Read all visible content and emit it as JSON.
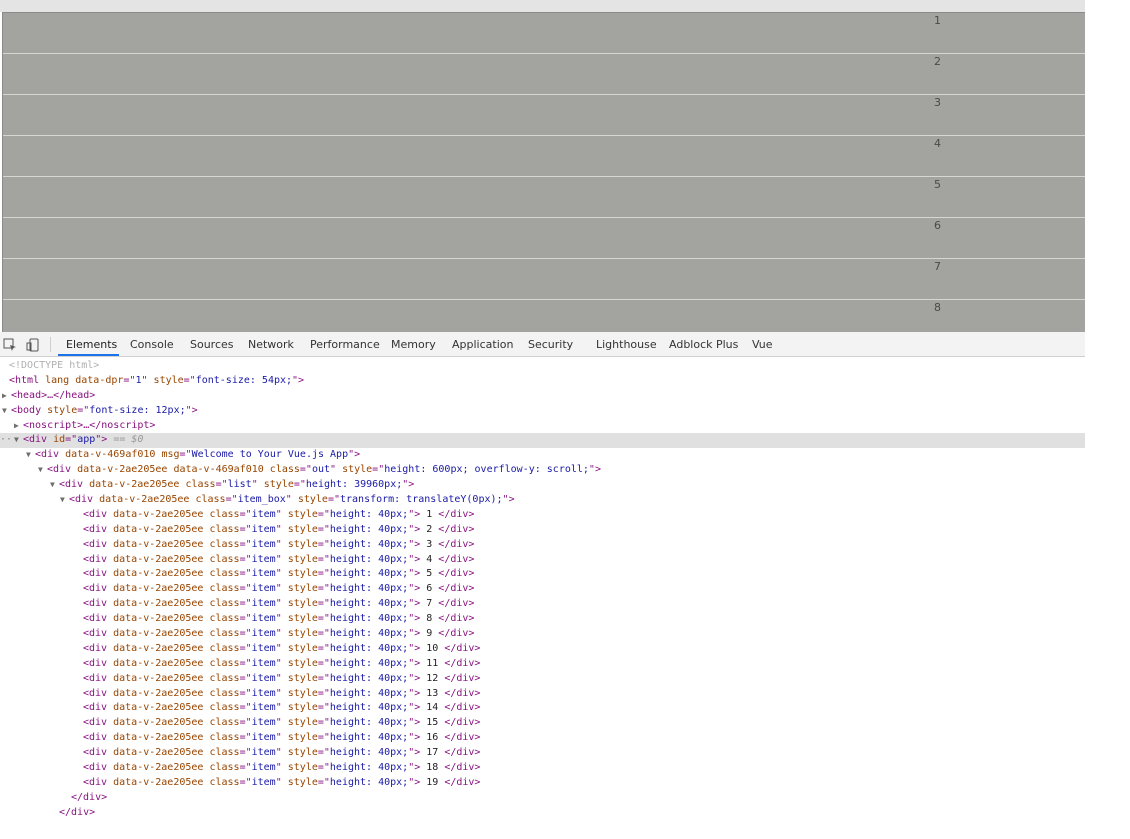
{
  "viewport": {
    "items": [
      "1",
      "2",
      "3",
      "4",
      "5",
      "6",
      "7",
      "8"
    ]
  },
  "devtools": {
    "tabs": [
      "Elements",
      "Console",
      "Sources",
      "Network",
      "Performance",
      "Memory",
      "Application",
      "Security",
      "Lighthouse",
      "Adblock Plus",
      "Vue"
    ],
    "active_tab": "Elements",
    "dom": {
      "doctype": "<!DOCTYPE html>",
      "html_open": {
        "tag": "html",
        "lang_attr": "lang",
        "dpr_attr": "data-dpr",
        "dpr_val": "1",
        "style_attr": "style",
        "style_val": "font-size: 54px;"
      },
      "head": "<head>…</head>",
      "body_open": {
        "style_val": "font-size: 12px;"
      },
      "noscript": "<noscript>…</noscript>",
      "app": {
        "id_val": "app",
        "marker": "== $0"
      },
      "hello": {
        "attr": "data-v-469af010",
        "msg_val": "Welcome to Your Vue.js App"
      },
      "out": {
        "attr1": "data-v-2ae205ee",
        "attr2": "data-v-469af010",
        "class_val": "out",
        "style_val": "height: 600px; overflow-y: scroll;"
      },
      "list": {
        "attr": "data-v-2ae205ee",
        "class_val": "list",
        "style_val": "height: 39960px;"
      },
      "item_box": {
        "attr": "data-v-2ae205ee",
        "class_val": "item_box",
        "style_val": "transform: translateY(0px);"
      },
      "item_attr": "data-v-2ae205ee",
      "item_class": "item",
      "item_style": "height: 40px;",
      "item_values": [
        "1",
        "2",
        "3",
        "4",
        "5",
        "6",
        "7",
        "8",
        "9",
        "10",
        "11",
        "12",
        "13",
        "14",
        "15",
        "16",
        "17",
        "18",
        "19"
      ],
      "close_div": "</div>"
    }
  },
  "colors": {
    "viewport_bg": "#a3a3a0",
    "tag": "#881280",
    "attr": "#994500",
    "value": "#1a1aa6",
    "active_tab_underline": "#1a73e8"
  }
}
